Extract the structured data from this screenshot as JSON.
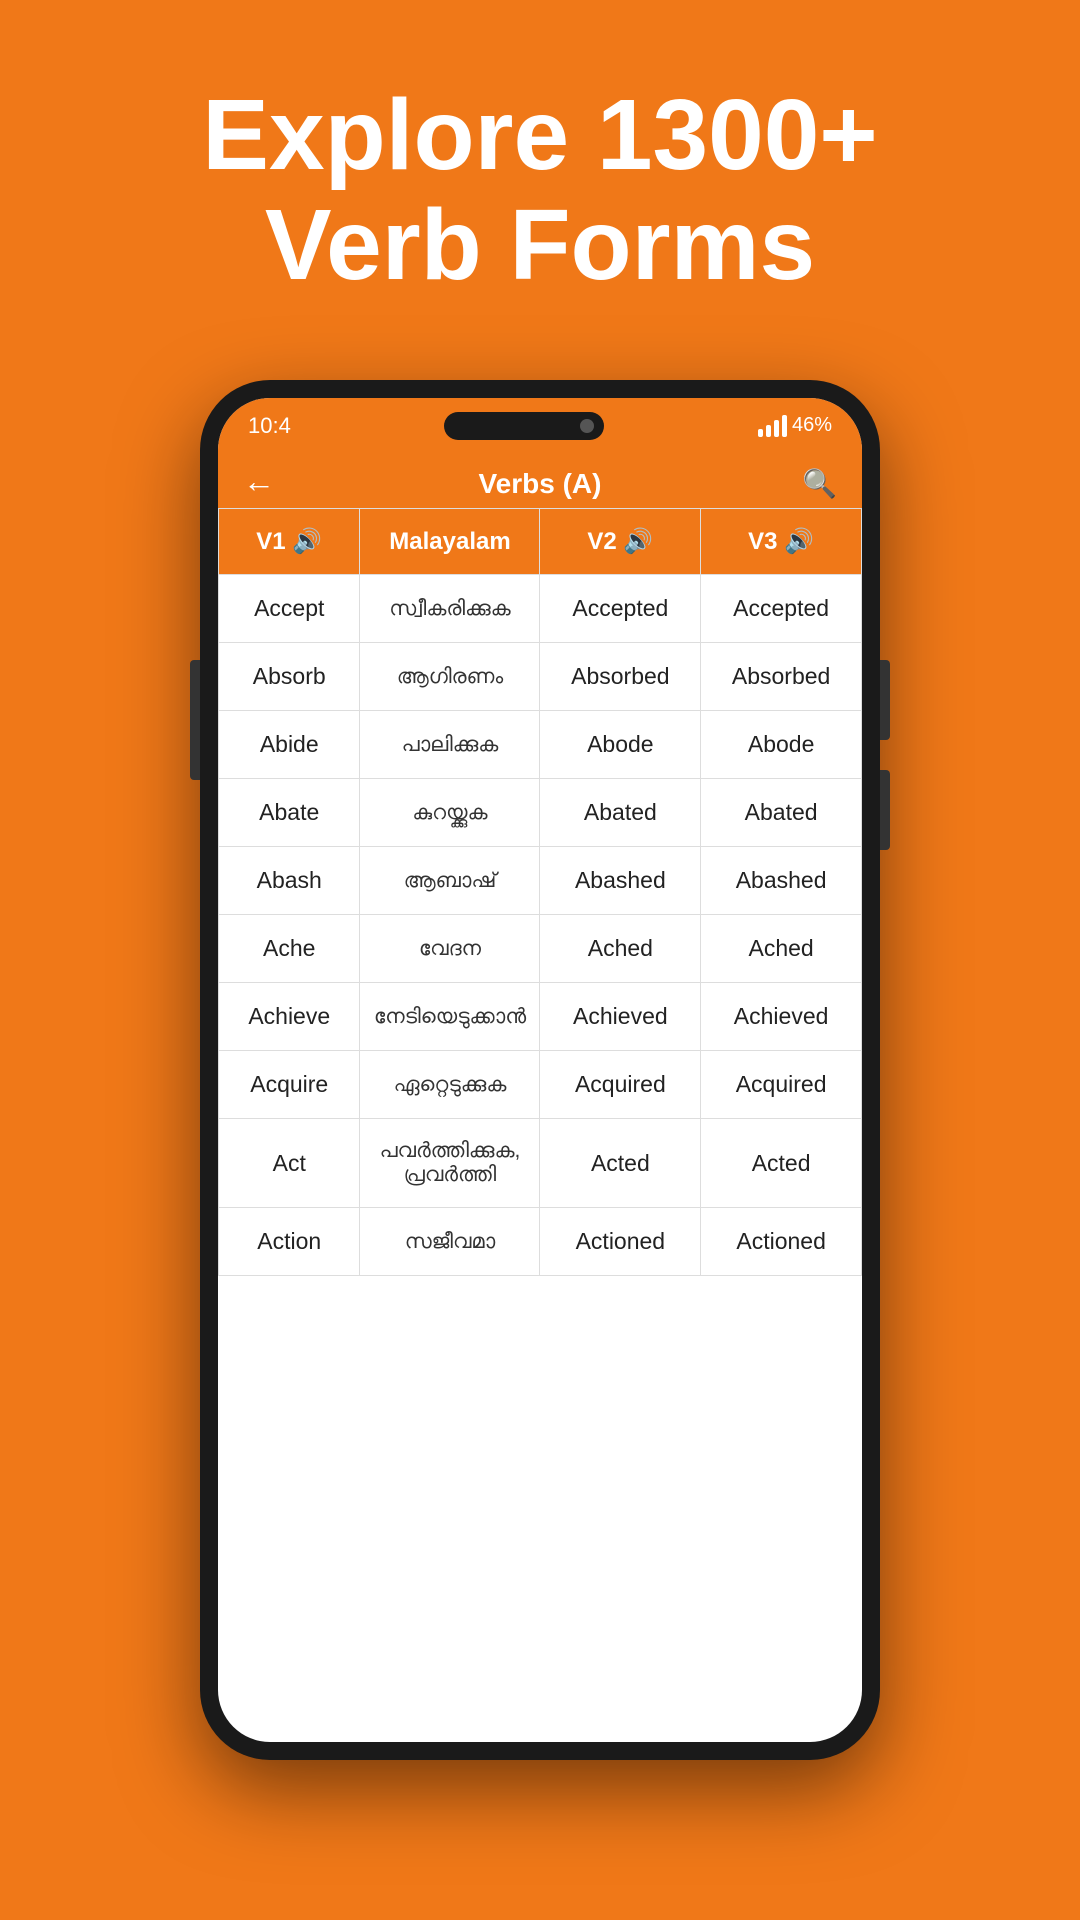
{
  "hero": {
    "line1": "Explore 1300+",
    "line2": "Verb Forms"
  },
  "status_bar": {
    "time": "10:4",
    "battery": "46%"
  },
  "app_header": {
    "title": "Verbs (A)",
    "back_label": "←",
    "search_label": "🔍"
  },
  "table": {
    "headers": [
      {
        "label": "V1",
        "has_sound": true
      },
      {
        "label": "Malayalam",
        "has_sound": false
      },
      {
        "label": "V2",
        "has_sound": true
      },
      {
        "label": "V3",
        "has_sound": true
      }
    ],
    "rows": [
      {
        "v1": "Accept",
        "ml": "സ്വീകരിക്കുക",
        "v2": "Accepted",
        "v3": "Accepted"
      },
      {
        "v1": "Absorb",
        "ml": "ആഗിരണം",
        "v2": "Absorbed",
        "v3": "Absorbed"
      },
      {
        "v1": "Abide",
        "ml": "പാലിക്കുക",
        "v2": "Abode",
        "v3": "Abode"
      },
      {
        "v1": "Abate",
        "ml": "കുറയ്ക്കുക",
        "v2": "Abated",
        "v3": "Abated"
      },
      {
        "v1": "Abash",
        "ml": "ആബാഷ്",
        "v2": "Abashed",
        "v3": "Abashed"
      },
      {
        "v1": "Ache",
        "ml": "വേദന",
        "v2": "Ached",
        "v3": "Ached"
      },
      {
        "v1": "Achieve",
        "ml": "നേടിയെടുക്കാൻ",
        "v2": "Achieved",
        "v3": "Achieved"
      },
      {
        "v1": "Acquire",
        "ml": "ഏറ്റെടുക്കുക",
        "v2": "Acquired",
        "v3": "Acquired"
      },
      {
        "v1": "Act",
        "ml": "പവർത്തിക്കുക, പ്രവർത്തി",
        "v2": "Acted",
        "v3": "Acted"
      },
      {
        "v1": "Action",
        "ml": "സജീവമാ",
        "v2": "Actioned",
        "v3": "Actioned"
      }
    ]
  }
}
